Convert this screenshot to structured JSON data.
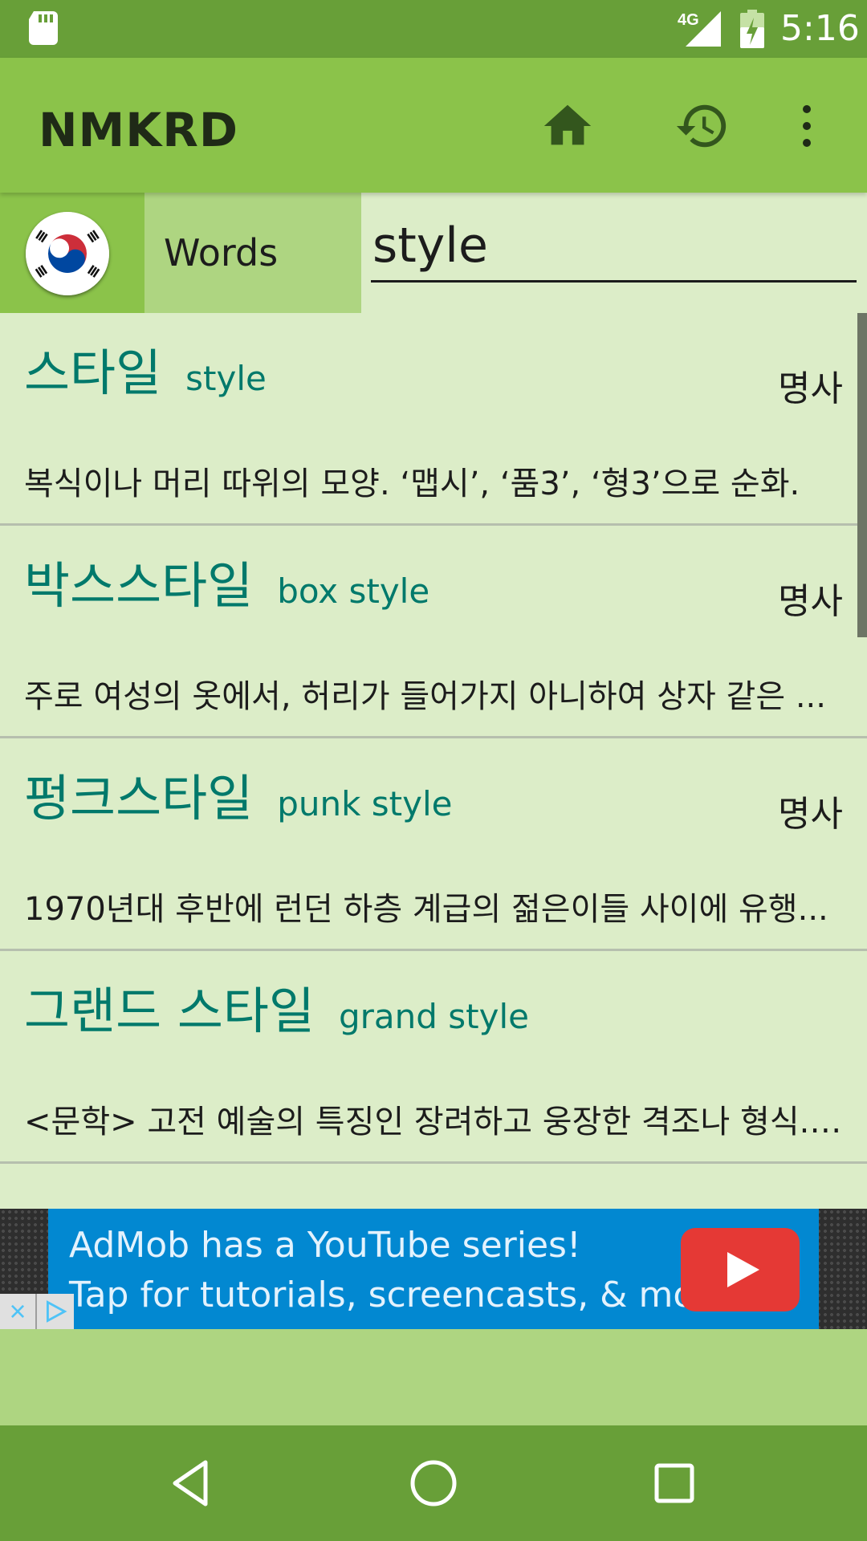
{
  "status_bar": {
    "network_label": "4G",
    "time": "5:16"
  },
  "app_bar": {
    "title": "NMKRD",
    "icons": [
      "home-icon",
      "history-icon",
      "more-vert-icon"
    ]
  },
  "search": {
    "language_flag": "korea-flag-icon",
    "mode_label": "Words",
    "query": "style"
  },
  "results": [
    {
      "korean": "스타일",
      "english": "style",
      "pos": "명사",
      "definition": "복식이나 머리 따위의 모양. ‘맵시’, ‘품3’, ‘형3’으로 순화."
    },
    {
      "korean": "박스스타일",
      "english": "box style",
      "pos": "명사",
      "definition": "주로 여성의 옷에서, 허리가 들어가지 아니하여 상자 같은 ..."
    },
    {
      "korean": "펑크스타일",
      "english": "punk style",
      "pos": "명사",
      "definition": "1970년대 후반에 런던 하층 계급의 젊은이들 사이에 유행..."
    },
    {
      "korean": "그랜드 스타일",
      "english": "grand style",
      "pos": "",
      "definition": "<문학> 고전 예술의 특징인 장려하고 웅장한 격조나 형식. ..."
    }
  ],
  "ad": {
    "line1": "AdMob has a YouTube series!",
    "line2": "Tap for tutorials, screencasts, & more.",
    "close_glyph": "×"
  },
  "colors": {
    "status_bar": "#689f38",
    "app_bar": "#8bc34a",
    "list_bg": "#dcedc8",
    "accent_text": "#00796b",
    "ad_blue": "#0288d1"
  }
}
